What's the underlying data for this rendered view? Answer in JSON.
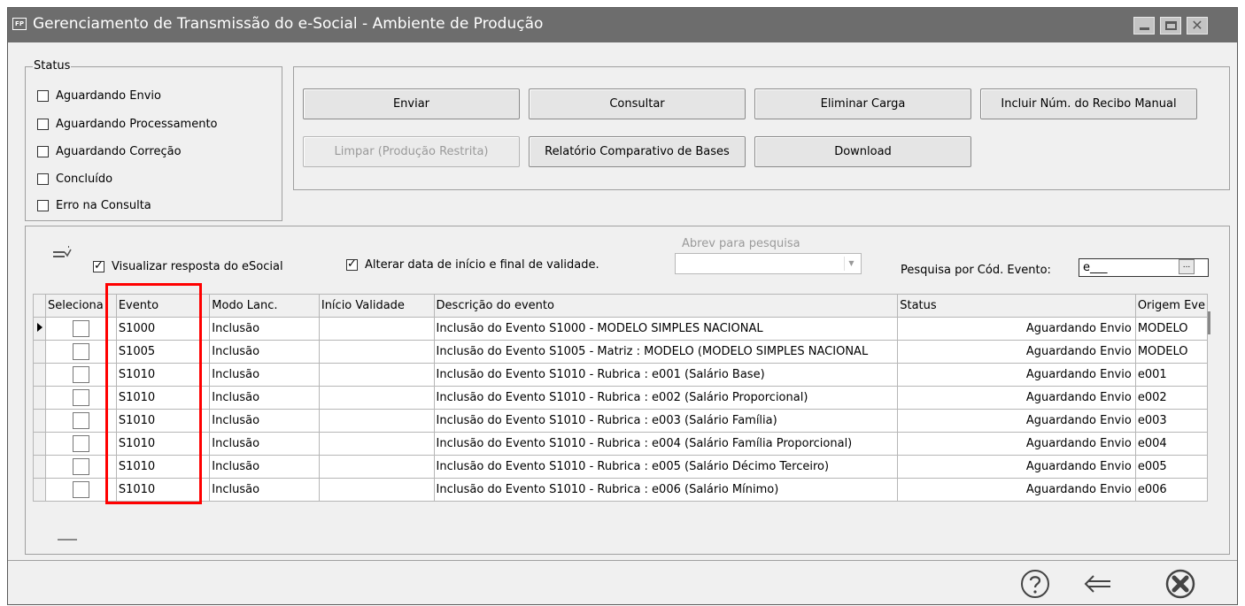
{
  "window": {
    "app_icon": "FP",
    "title": "Gerenciamento de Transmissão do e-Social - Ambiente de Produção",
    "close_glyph": "✕"
  },
  "status": {
    "legend": "Status",
    "options": [
      {
        "label": "Aguardando Envio",
        "checked": false
      },
      {
        "label": "Aguardando Processamento",
        "checked": false
      },
      {
        "label": "Aguardando Correção",
        "checked": false
      },
      {
        "label": "Concluído",
        "checked": false
      },
      {
        "label": "Erro na Consulta",
        "checked": false
      }
    ]
  },
  "actions": {
    "enviar": "Enviar",
    "consultar": "Consultar",
    "eliminar": "Eliminar Carga",
    "incluir_recibo": "Incluir Núm. do Recibo Manual",
    "limpar": "Limpar (Produção Restrita)",
    "relatorio": "Relatório Comparativo de Bases",
    "download": "Download"
  },
  "options": {
    "visualizar_resposta": {
      "label": "Visualizar resposta do eSocial",
      "checked": true
    },
    "alterar_data": {
      "label": "Alterar data de início e final de validade.",
      "checked": true
    },
    "abrev_label": "Abrev para pesquisa",
    "abrev_value": "",
    "pesquisa_label": "Pesquisa por Cód. Evento:",
    "pesquisa_value": "e___",
    "ellipsis": "..."
  },
  "grid": {
    "columns": [
      "Seleciona",
      "Evento",
      "Modo Lanc.",
      "Início Validade",
      "Descrição do evento",
      "Status",
      "Origem Eve"
    ],
    "rows": [
      {
        "evento": "S1000",
        "modo": "Inclusão",
        "inicio": "",
        "descricao": "Inclusão do Evento S1000 - MODELO SIMPLES NACIONAL",
        "status": "Aguardando Envio",
        "origem": "MODELO",
        "current": true
      },
      {
        "evento": "S1005",
        "modo": "Inclusão",
        "inicio": "",
        "descricao": "Inclusão do Evento S1005 - Matriz : MODELO (MODELO SIMPLES NACIONAL",
        "status": "Aguardando Envio",
        "origem": "MODELO",
        "current": false
      },
      {
        "evento": "S1010",
        "modo": "Inclusão",
        "inicio": "",
        "descricao": "Inclusão do Evento S1010 - Rubrica : e001 (Salário Base)",
        "status": "Aguardando Envio",
        "origem": "e001",
        "current": false
      },
      {
        "evento": "S1010",
        "modo": "Inclusão",
        "inicio": "",
        "descricao": "Inclusão do Evento S1010 - Rubrica : e002 (Salário Proporcional)",
        "status": "Aguardando Envio",
        "origem": "e002",
        "current": false
      },
      {
        "evento": "S1010",
        "modo": "Inclusão",
        "inicio": "",
        "descricao": "Inclusão do Evento S1010 - Rubrica : e003 (Salário Família)",
        "status": "Aguardando Envio",
        "origem": "e003",
        "current": false
      },
      {
        "evento": "S1010",
        "modo": "Inclusão",
        "inicio": "",
        "descricao": "Inclusão do Evento S1010 - Rubrica : e004 (Salário Família Proporcional)",
        "status": "Aguardando Envio",
        "origem": "e004",
        "current": false
      },
      {
        "evento": "S1010",
        "modo": "Inclusão",
        "inicio": "",
        "descricao": "Inclusão do Evento S1010 - Rubrica : e005 (Salário Décimo Terceiro)",
        "status": "Aguardando Envio",
        "origem": "e005",
        "current": false
      },
      {
        "evento": "S1010",
        "modo": "Inclusão",
        "inicio": "",
        "descricao": "Inclusão do Evento S1010 - Rubrica : e006 (Salário Mínimo)",
        "status": "Aguardando Envio",
        "origem": "e006",
        "current": false
      }
    ]
  },
  "footer": {
    "help_icon": "question-circle-icon",
    "back_icon": "arrow-left-icon",
    "close_icon": "close-circle-icon"
  },
  "colors": {
    "titlebar": "#6d6d6d",
    "highlight": "#ff0000",
    "window_bg": "#f0f0f0"
  }
}
